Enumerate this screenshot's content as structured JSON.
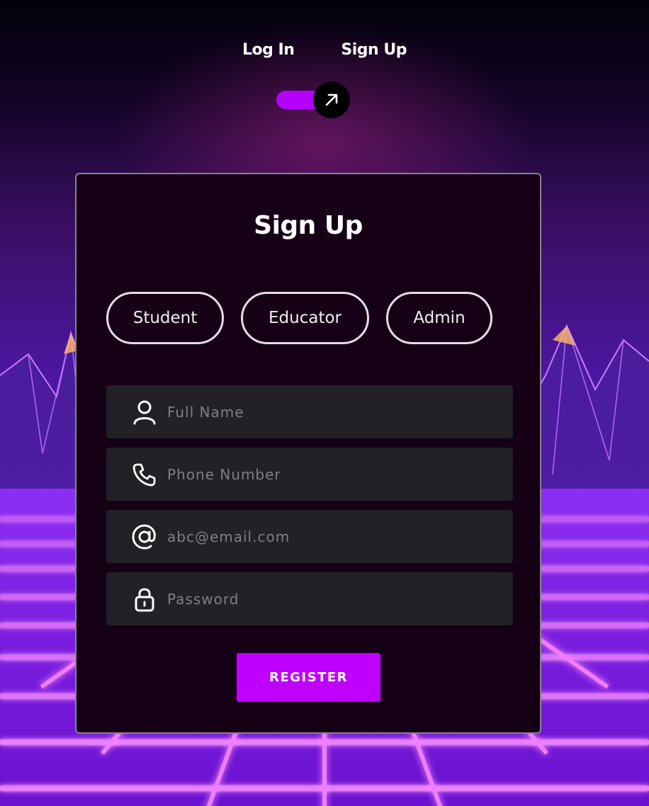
{
  "nav": {
    "tabs": [
      "Log In",
      "Sign Up"
    ],
    "toggle_icon": "arrow-up-right-icon"
  },
  "card": {
    "title": "Sign Up",
    "roles": [
      "Student",
      "Educator",
      "Admin"
    ],
    "fields": [
      {
        "icon": "user-icon",
        "placeholder": "Full Name"
      },
      {
        "icon": "phone-icon",
        "placeholder": "Phone Number"
      },
      {
        "icon": "at-sign-icon",
        "placeholder": "abc@email.com"
      },
      {
        "icon": "lock-icon",
        "placeholder": "Password"
      }
    ],
    "submit_label": "REGISTER"
  },
  "colors": {
    "accent": "#c000ff",
    "card_bg": "#160016",
    "field_bg": "#212126",
    "toggle_knob": "#000000"
  }
}
